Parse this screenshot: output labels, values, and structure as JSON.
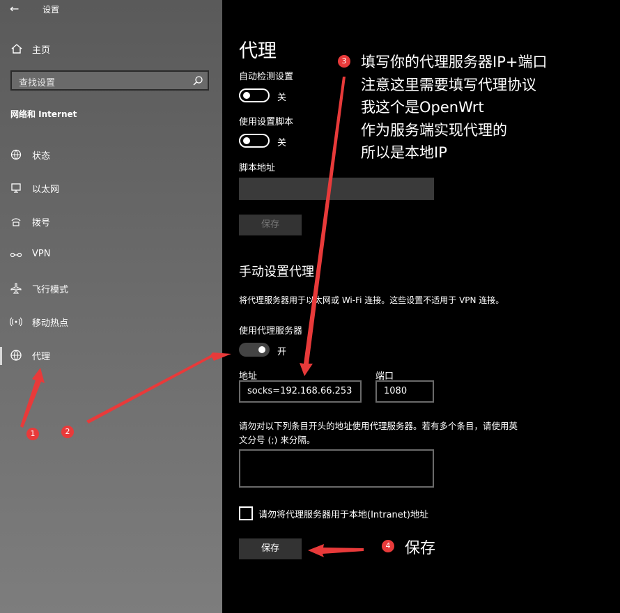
{
  "window": {
    "back_label": "←",
    "title": "设置"
  },
  "sidebar": {
    "home": "主页",
    "search_placeholder": "查找设置",
    "section": "网络和 Internet",
    "items": [
      {
        "label": "状态",
        "icon": "globe-status-icon"
      },
      {
        "label": "以太网",
        "icon": "monitor-icon"
      },
      {
        "label": "拨号",
        "icon": "dialup-icon"
      },
      {
        "label": "VPN",
        "icon": "vpn-icon"
      },
      {
        "label": "飞行模式",
        "icon": "airplane-icon"
      },
      {
        "label": "移动热点",
        "icon": "hotspot-icon"
      },
      {
        "label": "代理",
        "icon": "globe-icon"
      }
    ],
    "selected": "代理"
  },
  "main": {
    "page_title": "代理",
    "auto_detect_label": "自动检测设置",
    "auto_detect_state": "关",
    "use_script_label": "使用设置脚本",
    "use_script_state": "关",
    "script_address_label": "脚本地址",
    "script_address_value": "",
    "script_save_button": "保存",
    "manual_heading": "手动设置代理",
    "manual_desc": "将代理服务器用于以太网或 Wi-Fi 连接。这些设置不适用于 VPN 连接。",
    "use_proxy_label": "使用代理服务器",
    "use_proxy_state": "开",
    "address_label": "地址",
    "address_value": "socks=192.168.66.253",
    "port_label": "端口",
    "port_value": "1080",
    "exceptions_desc_line1": "请勿对以下列条目开头的地址使用代理服务器。若有多个条目，请使用英",
    "exceptions_desc_line2": "文分号 (;) 来分隔。",
    "exceptions_value": "",
    "bypass_local_label": "请勿将代理服务器用于本地(Intranet)地址",
    "bypass_local_checked": false,
    "save_button": "保存"
  },
  "annotations": {
    "badges": [
      "1",
      "2",
      "3",
      "4"
    ],
    "note3_lines": [
      "填写你的代理服务器IP+端口",
      "注意这里需要填写代理协议",
      "我这个是OpenWrt",
      "作为服务端实现代理的",
      "所以是本地IP"
    ],
    "note4": "保存",
    "color": "#e83a3a"
  }
}
